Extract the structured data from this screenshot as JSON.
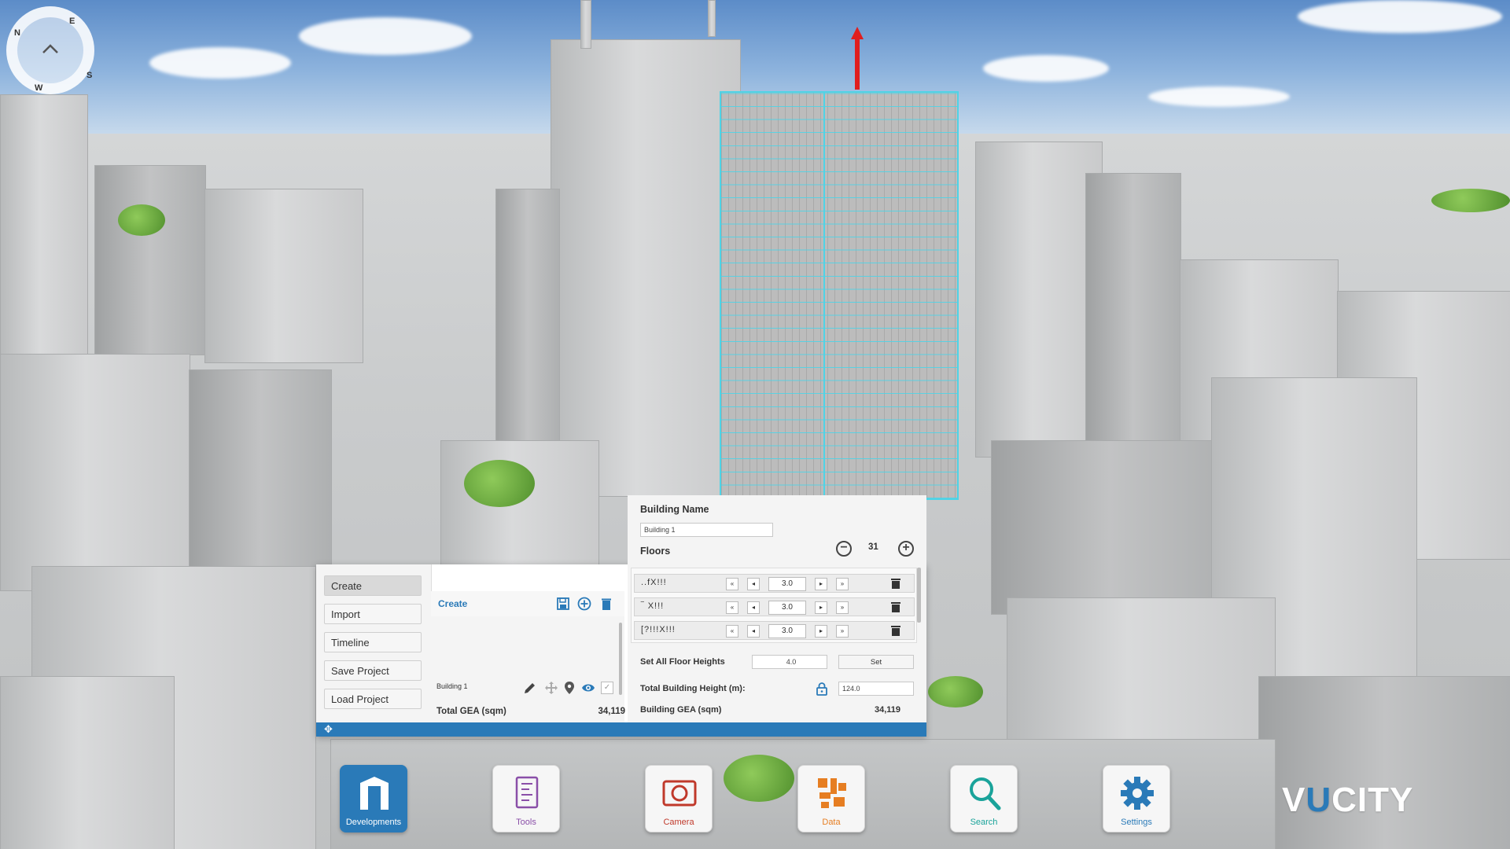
{
  "compass": {
    "n": "N",
    "e": "E",
    "s": "S",
    "w": "W"
  },
  "menu": {
    "items": [
      {
        "label": "Create"
      },
      {
        "label": "Import"
      },
      {
        "label": "Timeline"
      },
      {
        "label": "Save Project"
      },
      {
        "label": "Load Project"
      }
    ]
  },
  "list": {
    "title": "Create",
    "building": "Building 1",
    "total_gea_label": "Total GEA (sqm)",
    "total_gea_value": "34,119"
  },
  "editor": {
    "name_label": "Building Name",
    "name_value": "Building 1",
    "floors_label": "Floors",
    "floors_count": "31",
    "floor_rows": [
      {
        "name": "..fX!!!",
        "value": "3.0"
      },
      {
        "name": "‾ X!!!",
        "value": "3.0"
      },
      {
        "name": "[?!!!X!!!",
        "value": "3.0"
      }
    ],
    "set_all_label": "Set All Floor Heights",
    "set_all_value": "4.0",
    "set_button": "Set",
    "total_height_label": "Total Building Height (m):",
    "total_height_value": "124.0",
    "gea_label": "Building GEA (sqm)",
    "gea_value": "34,119"
  },
  "dock": [
    {
      "label": "Developments",
      "icon": "developments-icon",
      "color": "#ffffff"
    },
    {
      "label": "Tools",
      "icon": "tools-icon",
      "color": "#8a4fa8"
    },
    {
      "label": "Camera",
      "icon": "camera-icon",
      "color": "#c0392b"
    },
    {
      "label": "Data",
      "icon": "data-icon",
      "color": "#e67e22"
    },
    {
      "label": "Search",
      "icon": "search-icon",
      "color": "#1aa39a"
    },
    {
      "label": "Settings",
      "icon": "gear-icon",
      "color": "#2a7ab8"
    }
  ],
  "logo": {
    "pre": "V",
    "accent": "U",
    "post": "CITY"
  },
  "colors": {
    "accent": "#2a7ab8",
    "highlight": "#4fd3e6",
    "arrow": "#e01e1e"
  }
}
